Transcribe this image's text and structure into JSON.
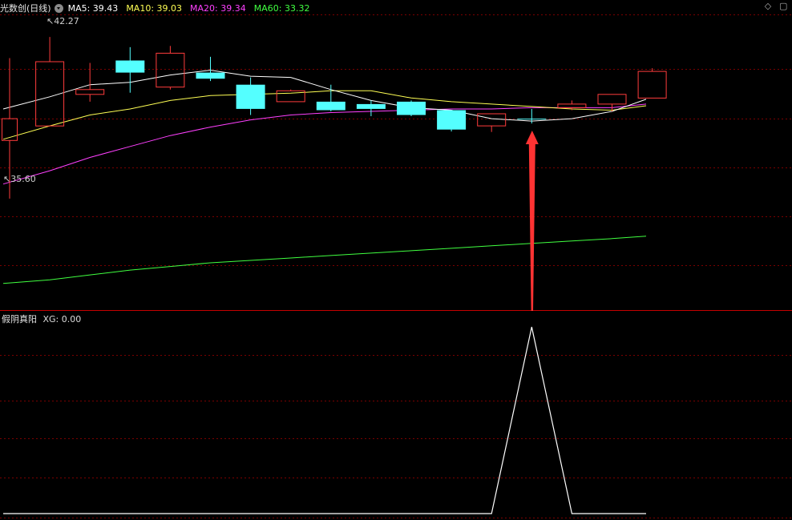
{
  "header": {
    "title": "光数创(日线)",
    "ma": [
      {
        "label": "MA5: 39.43",
        "color": "#ffffff"
      },
      {
        "label": "MA10: 39.03",
        "color": "#ffff54"
      },
      {
        "label": "MA20: 39.34",
        "color": "#ff40ff"
      },
      {
        "label": "MA60: 33.32",
        "color": "#40ff40"
      }
    ],
    "controls": [
      {
        "name": "diamond-icon",
        "glyph": "◇"
      },
      {
        "name": "collapse-icon",
        "glyph": "▢"
      }
    ]
  },
  "price_labels": {
    "high": "42.27",
    "low": "35.60"
  },
  "indicator": {
    "title": "假阴真阳",
    "xg_label": "XG: 0.00"
  },
  "colors": {
    "up": "#ff3c3c",
    "down": "#54ffff",
    "grid": "#7a0000",
    "border": "#c40000",
    "ma5": "#ffffff",
    "ma10": "#ffff54",
    "ma20": "#ff40ff",
    "ma60": "#40ff40",
    "arrow": "#ff3333",
    "xg": "#ffffff"
  },
  "chart_data": [
    {
      "type": "candlestick",
      "price_range": [
        31.0,
        43.2
      ],
      "candles": [
        {
          "o": 38.0,
          "c": 38.9,
          "h": 41.4,
          "l": 35.6
        },
        {
          "o": 38.6,
          "c": 41.25,
          "h": 42.27,
          "l": 38.6
        },
        {
          "o": 39.9,
          "c": 40.1,
          "h": 41.2,
          "l": 39.6
        },
        {
          "o": 41.3,
          "c": 40.8,
          "h": 41.85,
          "l": 39.97
        },
        {
          "o": 40.2,
          "c": 41.6,
          "h": 41.9,
          "l": 40.1
        },
        {
          "o": 40.8,
          "c": 40.55,
          "h": 41.45,
          "l": 40.45
        },
        {
          "o": 40.3,
          "c": 39.3,
          "h": 40.6,
          "l": 39.05
        },
        {
          "o": 39.6,
          "c": 40.05,
          "h": 40.1,
          "l": 39.6
        },
        {
          "o": 39.6,
          "c": 39.25,
          "h": 40.3,
          "l": 39.2
        },
        {
          "o": 39.5,
          "c": 39.3,
          "h": 39.65,
          "l": 39.0
        },
        {
          "o": 39.6,
          "c": 39.05,
          "h": 39.65,
          "l": 39.0
        },
        {
          "o": 39.25,
          "c": 38.45,
          "h": 39.25,
          "l": 38.37
        },
        {
          "o": 38.6,
          "c": 39.1,
          "h": 39.1,
          "l": 38.35
        },
        {
          "o": 38.88,
          "c": 38.88,
          "h": 39.3,
          "l": 38.7
        },
        {
          "o": 39.35,
          "c": 39.5,
          "h": 39.65,
          "l": 39.25
        },
        {
          "o": 39.5,
          "c": 39.9,
          "h": 39.9,
          "l": 39.2
        },
        {
          "o": 39.75,
          "c": 40.85,
          "h": 40.98,
          "l": 39.75
        }
      ],
      "ma5": [
        39.3,
        39.8,
        40.3,
        40.4,
        40.7,
        40.9,
        40.65,
        40.6,
        40.1,
        39.65,
        39.35,
        39.25,
        38.9,
        38.8,
        38.9,
        39.2,
        39.7
      ],
      "ma10": [
        38.05,
        38.6,
        39.05,
        39.3,
        39.65,
        39.85,
        39.9,
        39.95,
        40.05,
        40.05,
        39.75,
        39.6,
        39.5,
        39.4,
        39.3,
        39.25,
        39.43
      ],
      "ma20": [
        36.2,
        36.75,
        37.3,
        37.75,
        38.2,
        38.55,
        38.85,
        39.05,
        39.15,
        39.2,
        39.25,
        39.3,
        39.3,
        39.35,
        39.35,
        39.35,
        39.5
      ],
      "ma60": [
        32.1,
        32.25,
        32.45,
        32.65,
        32.8,
        32.95,
        33.05,
        33.15,
        33.25,
        33.35,
        33.45,
        33.55,
        33.65,
        33.75,
        33.85,
        33.95,
        34.05
      ],
      "annotations": [
        {
          "type": "arrow",
          "index": 13
        }
      ]
    },
    {
      "type": "line",
      "title": "假阴真阳",
      "ylim": [
        0,
        1
      ],
      "values": [
        0,
        0,
        0,
        0,
        0,
        0,
        0,
        0,
        0,
        0,
        0,
        0,
        0,
        1,
        0,
        0,
        0
      ]
    }
  ]
}
